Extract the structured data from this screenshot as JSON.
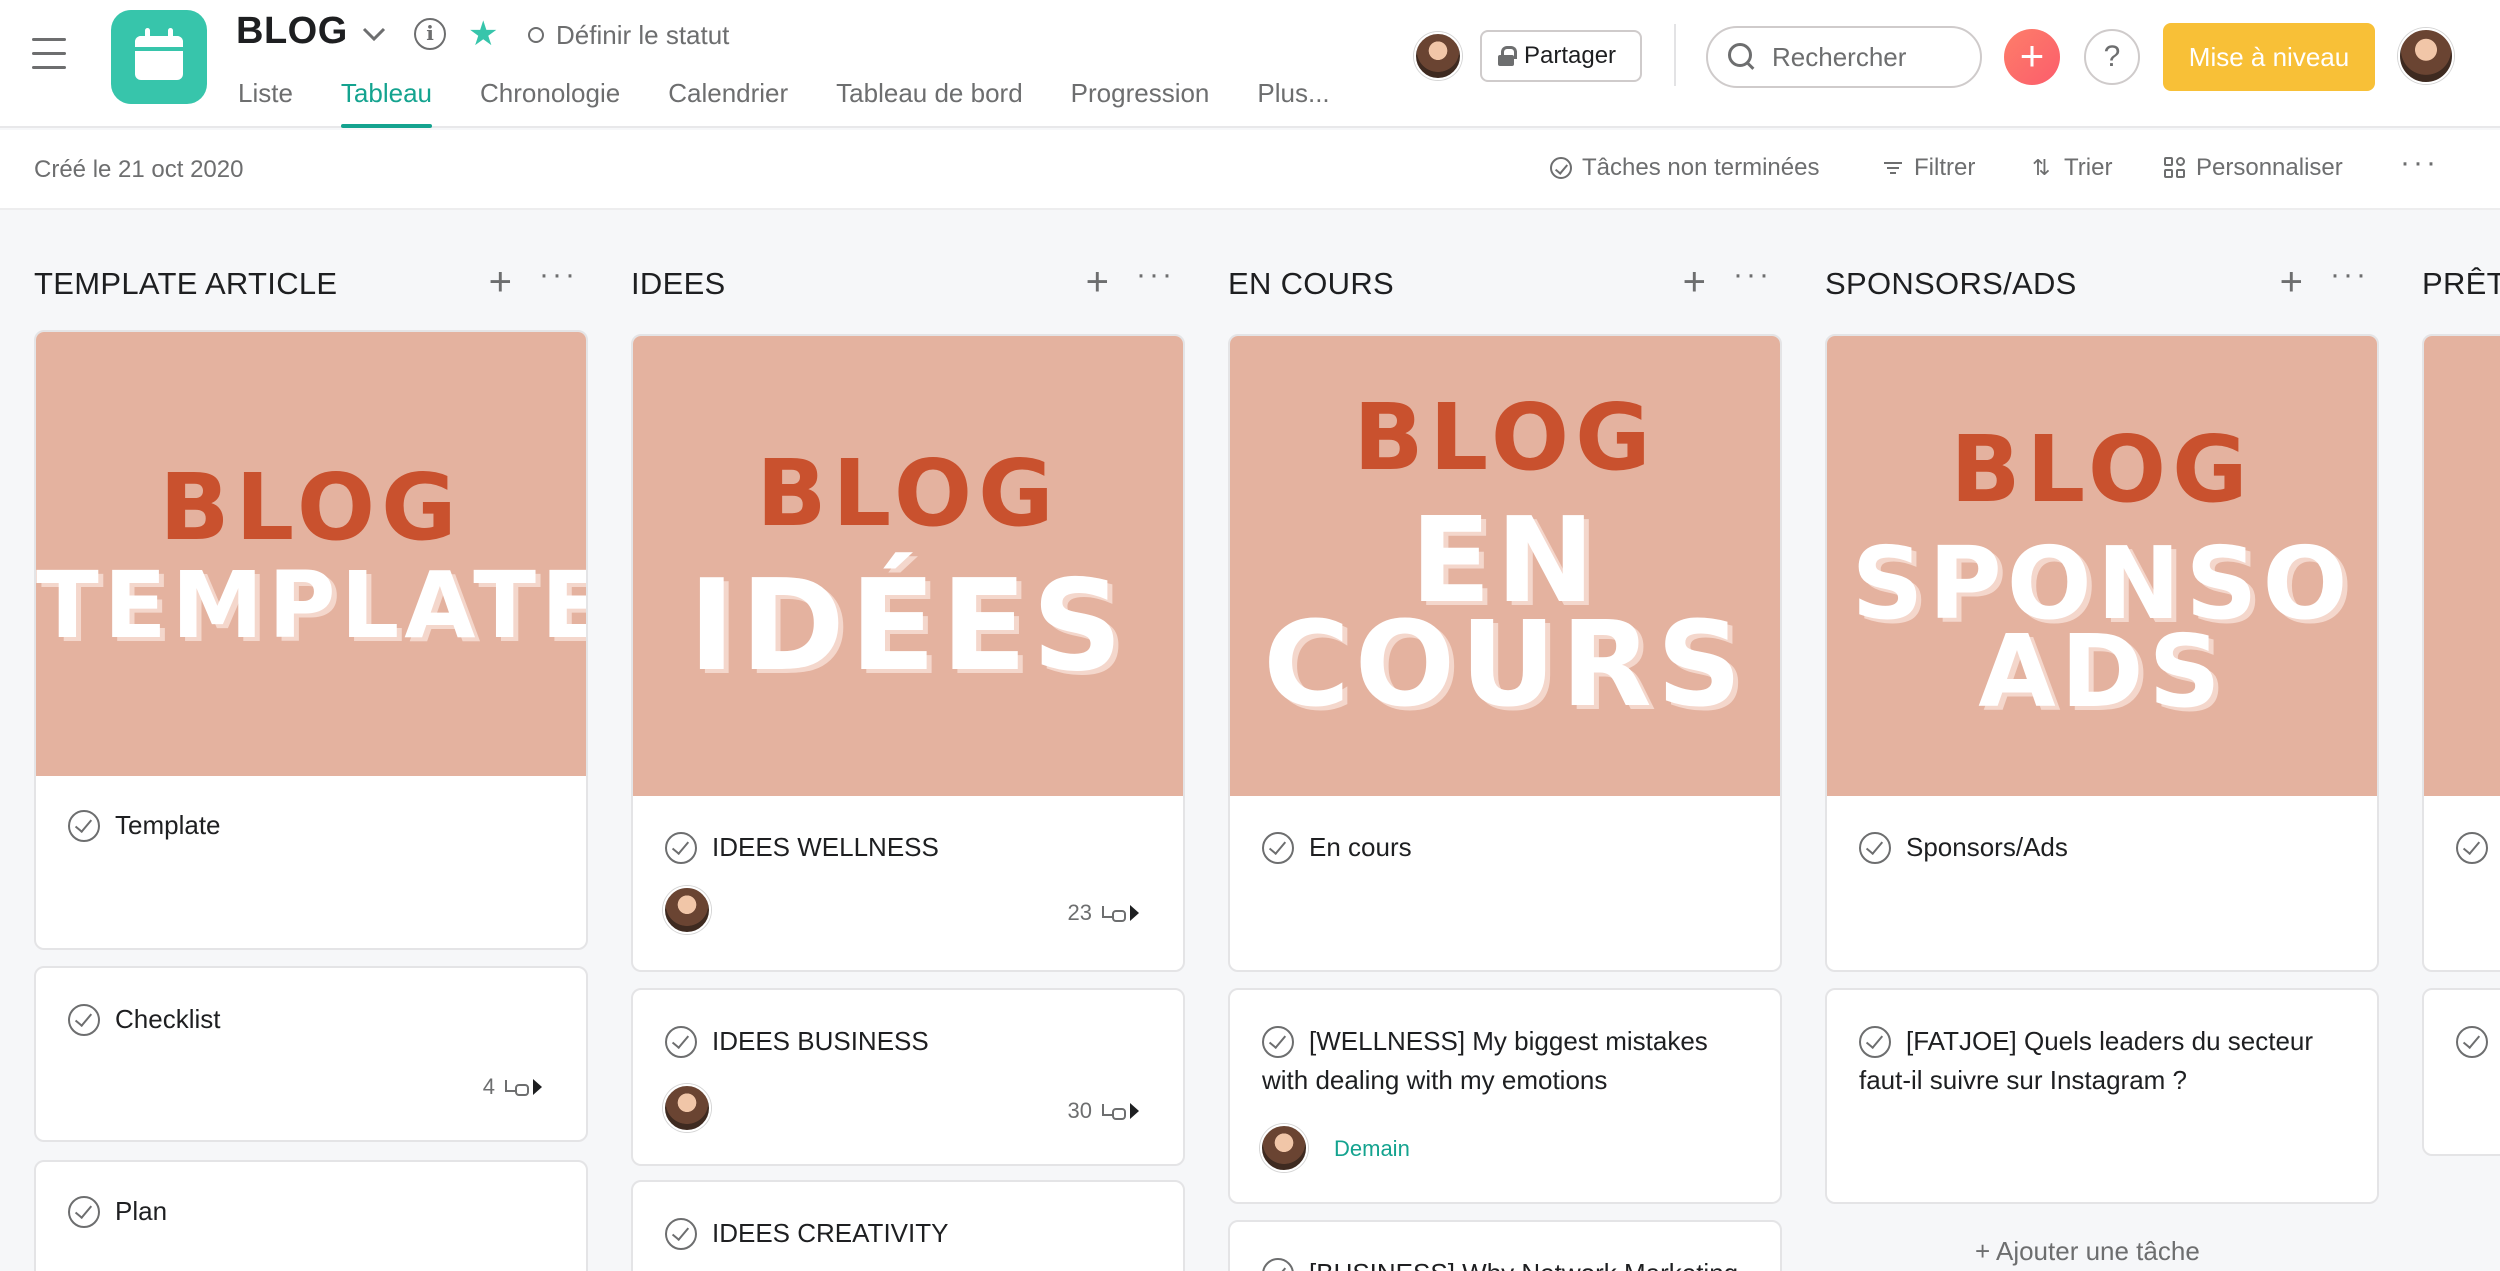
{
  "header": {
    "project_title": "BLOG",
    "status_label": "Définir le statut",
    "tabs": [
      {
        "label": "Liste"
      },
      {
        "label": "Tableau",
        "active": true
      },
      {
        "label": "Chronologie"
      },
      {
        "label": "Calendrier"
      },
      {
        "label": "Tableau de bord"
      },
      {
        "label": "Progression"
      },
      {
        "label": "Plus..."
      }
    ],
    "share_label": "Partager",
    "search_placeholder": "Rechercher",
    "add_symbol": "+",
    "help_symbol": "?",
    "upgrade_label": "Mise à niveau",
    "accent_color": "#14a38f",
    "upgrade_color": "#f8c037",
    "icons": [
      "hamburger-icon",
      "calendar-icon",
      "chevron-down-icon",
      "info-icon",
      "star-icon",
      "lock-icon",
      "search-icon"
    ]
  },
  "toolbar": {
    "created": "Créé le 21 oct 2020",
    "incomplete_tasks": "Tâches non terminées",
    "filter": "Filtrer",
    "sort": "Trier",
    "customize": "Personnaliser",
    "more": "···"
  },
  "board": {
    "column_more": "···",
    "column_plus": "+",
    "add_task_label": "+ Ajouter une tâche",
    "cover_color": "#e4b29f",
    "columns": [
      {
        "title": "TEMPLATE ARTICLE",
        "cover": {
          "top": "BLOG",
          "main": "TEMPLATE"
        },
        "cards": [
          {
            "name": "Template"
          },
          {
            "name": "Checklist",
            "subtasks": "4"
          },
          {
            "name": "Plan"
          }
        ]
      },
      {
        "title": "IDEES",
        "cover": {
          "top": "BLOG",
          "main": "IDÉES"
        },
        "cards": [
          {
            "name": "IDEES WELLNESS",
            "subtasks": "23"
          },
          {
            "name": "IDEES BUSINESS",
            "subtasks": "30"
          },
          {
            "name": "IDEES CREATIVITY"
          }
        ]
      },
      {
        "title": "EN COURS",
        "cover": {
          "top": "BLOG",
          "main_line1": "EN",
          "main_line2": "COURS"
        },
        "cards": [
          {
            "name": "En cours"
          },
          {
            "name_line1": "[WELLNESS] My biggest mistakes",
            "name_line2": "with dealing with my emotions",
            "due": "Demain"
          },
          {
            "name": "[BUSINESS] Why Network Marketing"
          }
        ]
      },
      {
        "title": "SPONSORS/ADS",
        "cover": {
          "top": "BLOG",
          "main_line1": "SPONSO",
          "main_line2": "ADS"
        },
        "cards": [
          {
            "name": "Sponsors/Ads"
          },
          {
            "name_line1": "[FATJOE] Quels leaders du secteur",
            "name_line2": "faut-il suivre sur Instagram ?"
          }
        ]
      },
      {
        "title": "PRÊT"
      }
    ]
  }
}
